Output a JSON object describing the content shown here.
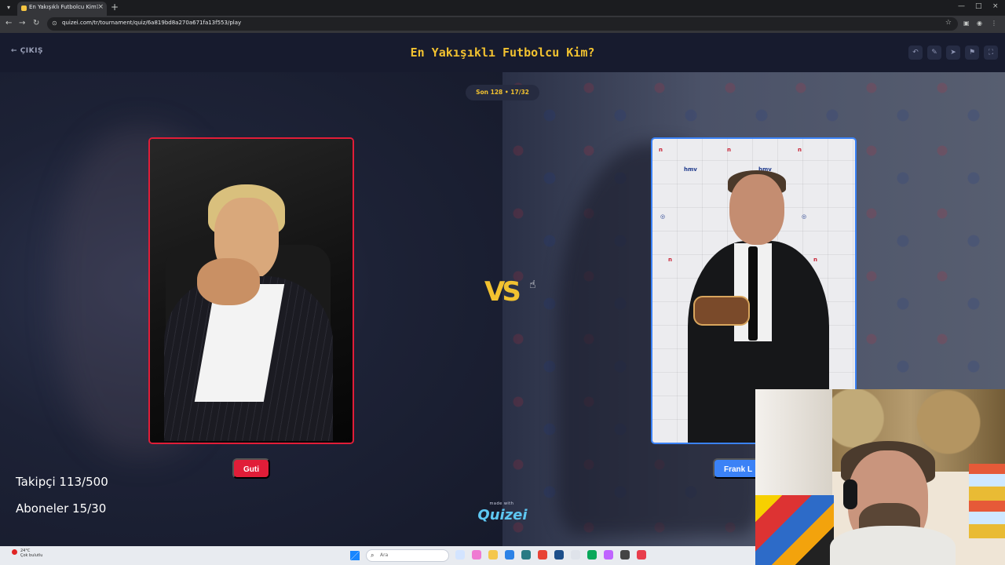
{
  "browser": {
    "tab_title": "En Yakışıklı Futbolcu Kim? - Tie",
    "url": "quizei.com/tr/tournament/quiz/6a819bd8a270a671fa13f553/play",
    "tab_menu_icon": "chevron-down-icon",
    "new_tab_icon": "plus-icon"
  },
  "app": {
    "back_label": "ÇIKIŞ",
    "title": "En Yakışıklı Futbolcu Kim?",
    "stage_pill": "Son 128 • 17/32",
    "contestants": [
      {
        "name": "Guti",
        "color": "#e11d38"
      },
      {
        "name": "Frank L",
        "color": "#3b82f6"
      }
    ],
    "vs_label": "VS",
    "made_with": "made with",
    "brand": "Quizei",
    "stats": {
      "followers": "Takipçi 113/500",
      "subscribers": "Aboneler 15/30"
    },
    "header_icons": [
      "undo-icon",
      "edit-icon",
      "share-icon",
      "flag-icon",
      "fullscreen-icon"
    ]
  },
  "taskbar": {
    "weather_temp": "24°C",
    "weather_desc": "Çok bulutlu",
    "search_label": "Ara"
  },
  "colors": {
    "accent": "#f2c230",
    "left_accent": "#e11d38",
    "right_accent": "#3b82f6",
    "background": "#151a2b"
  }
}
